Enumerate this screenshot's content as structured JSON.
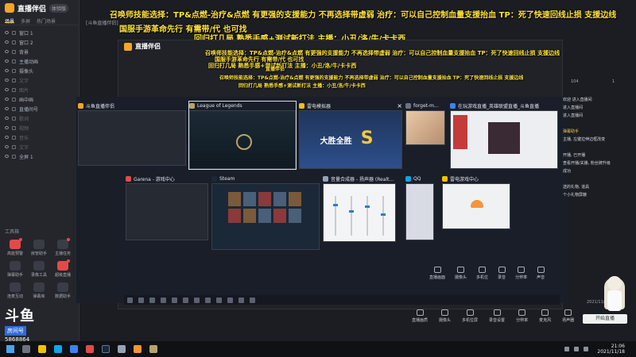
{
  "app": {
    "name": "直播伴侣",
    "badge": "体验版"
  },
  "left_tabs": [
    "场景",
    "多屏",
    "热门场景"
  ],
  "scenes": [
    {
      "label": "窗口 1"
    },
    {
      "label": "窗口 2"
    },
    {
      "label": "背景"
    },
    {
      "label": "主播动画"
    },
    {
      "label": "摄像头"
    },
    {
      "label": "文字"
    },
    {
      "label": "图片"
    },
    {
      "label": "画中画"
    },
    {
      "label": "直播间号"
    },
    {
      "label": "歌词"
    },
    {
      "label": "视频"
    },
    {
      "label": "音乐"
    },
    {
      "label": "文字"
    },
    {
      "label": "全屏 1"
    }
  ],
  "tools": {
    "title": "工具箱",
    "items": [
      "高能预警",
      "房管助手",
      "主播任务",
      "弹幕助手",
      "录像工具",
      "超级直播",
      "连麦互动",
      "弹幕库",
      "数据助手"
    ]
  },
  "streamer": {
    "logo": "斗鱼",
    "room_label": "房间号",
    "room_number": "5868864"
  },
  "window_title": "[斗鱼直播伴侣]",
  "overlay": {
    "line1": "召唤师技能选择：TP&点燃-治疗&点燃  有更强的支援能力 不再选择带虚弱 治疗：可以自己控制血量支援抬血 TP：死了快速回线止损 支援边线",
    "line2": "国服手游革命先行 有需带/代 也可找",
    "line3": "回归打几局 熟悉手感+测试新打法   主播：小丑/洛/牛/卡卡西"
  },
  "inner": {
    "app_name": "直播伴侣",
    "o1": "召唤师技能选择：TP&点燃-治疗&点燃  有更强的支援能力 不再选择带虚弱 治疗：可以自己控制血量支援抬血 TP：死了快速回线止损 支援边线",
    "o2": "国服手游革命先行 有需带/代 也可找",
    "o3": "回归打几局 熟悉手感+测试新打法   主播：小丑/洛/牛/卡卡西",
    "o4": "直播伴侣",
    "o5": "召唤师技能选择：TP&点燃-治疗&点燃  有更强的支援能力 不再选择带虚弱 治疗：可以自己控制血量支援抬血 TP：死了快速回线止损 支援边线",
    "o6": "回归打几局 熟悉手感+测试新打法   主播：小丑/洛/牛/卡卡西"
  },
  "tasks": [
    {
      "title": "斗鱼直播伴侣"
    },
    {
      "title": "League of Legends"
    },
    {
      "title": "雷电模拟器"
    },
    {
      "title": "forget-m..."
    },
    {
      "title": "在玩游戏直播_英雄联盟直播_斗鱼直播"
    },
    {
      "title": "Garena - 游戏中心"
    },
    {
      "title": "Steam"
    },
    {
      "title": "音量合成器 - 扬声器 (Realt..."
    },
    {
      "title": "QQ"
    },
    {
      "title": "雷电游戏中心"
    }
  ],
  "victory_text": "大胜全胜",
  "victory_big": "S",
  "chat": [
    "欢迎 进入直播间",
    "进入直播间",
    "进入直播间",
    "",
    "弹幕助手",
    "主播, 左键拉伸边框改变",
    "",
    "开播, 已开播",
    "查看开播/关播, 粉丝牌升级",
    "成功",
    "",
    "送的礼物, 道具",
    "个小礼物屏蔽"
  ],
  "counts": {
    "a": "104",
    "b": "1"
  },
  "inner_bottom": [
    "直播画面",
    "摄像头",
    "多机位",
    "录音",
    "分辨率",
    "声音"
  ],
  "outer_bottom": [
    "直播画质",
    "摄像头",
    "多机位屏",
    "录音设置",
    "分辨率",
    "麦克风",
    "扬声器"
  ],
  "live_button": "开始直播",
  "version": "2021/11/18",
  "clock": {
    "time": "21:06",
    "date": "2021/11/18"
  },
  "colors": {
    "overlay_yellow": "#ffe23b",
    "brand": "#f5a623",
    "room_blue": "#2e6bd8"
  }
}
